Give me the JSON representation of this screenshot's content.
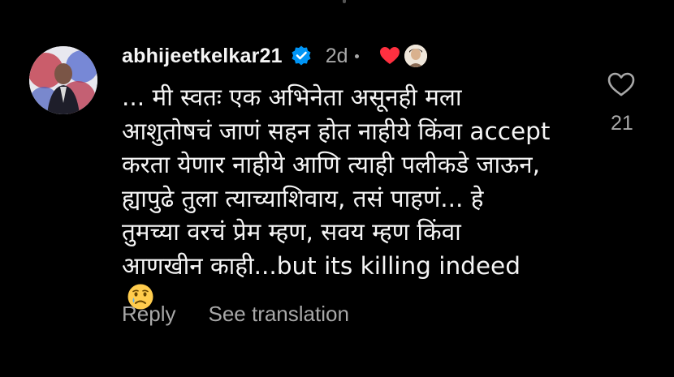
{
  "comment": {
    "username": "abhijeetkelkar21",
    "age": "2d",
    "lines": [
      "... मी स्वतः एक अभिनेता असूनही मला",
      "आशुतोषचं जाणं सहन होत नाहीये किंवा accept",
      "करता येणार नाहीये आणि त्याही पलीकडे जाऊन,",
      "ह्यापुढे तुला त्याच्याशिवाय, तसं पाहणं... हे",
      "तुमच्या वरचं प्रेम म्हण, सवय म्हण किंवा",
      "आणखीन काही...but its killing indeed"
    ],
    "reply_label": "Reply",
    "translate_label": "See translation",
    "like_count": "21"
  },
  "icons": {
    "verified": "verified-badge-icon",
    "creator_like": "red-heart-icon",
    "emoji": "sad-tear-emoji",
    "like": "heart-outline-icon"
  },
  "colors": {
    "background": "#000000",
    "text": "#f5f5f5",
    "muted": "#a8a8a8",
    "verified_blue": "#0095f6",
    "heart_red": "#ff3040"
  }
}
